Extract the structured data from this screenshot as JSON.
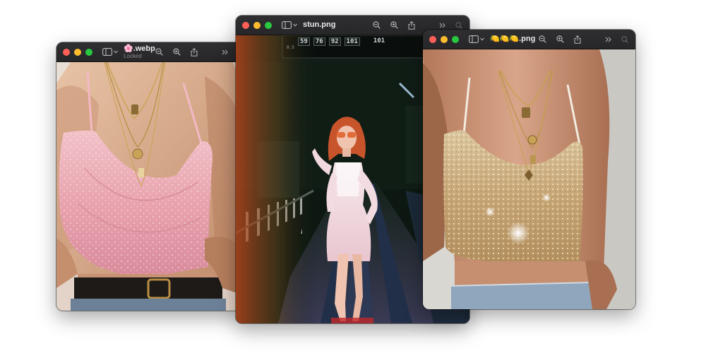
{
  "windows": [
    {
      "title": "🌸.webp",
      "subtitle": "Locked",
      "icons": [
        "sidebar-icon",
        "zoom-out-icon",
        "zoom-in-icon",
        "share-icon",
        "chevron-double-right-icon",
        "search-icon"
      ]
    },
    {
      "title": "stun.png",
      "icons": [
        "sidebar-icon",
        "zoom-out-icon",
        "zoom-in-icon",
        "share-icon",
        "chevron-double-right-icon",
        "search-icon"
      ],
      "scoreboard": {
        "numbers": [
          "59",
          "76",
          "92",
          "101",
          "101"
        ],
        "small": "0.5"
      }
    },
    {
      "title": "🍋🍋🍋.png",
      "icons": [
        "sidebar-icon",
        "zoom-out-icon",
        "zoom-in-icon",
        "share-icon",
        "chevron-double-right-icon",
        "search-icon"
      ]
    }
  ],
  "colors": {
    "titlebar": "#2a2a2d",
    "red": "#ff5f57",
    "yellow": "#febc2e",
    "green": "#28c840",
    "pink_top": "#e9a7b3",
    "gold_top": "#c9ad7e"
  }
}
